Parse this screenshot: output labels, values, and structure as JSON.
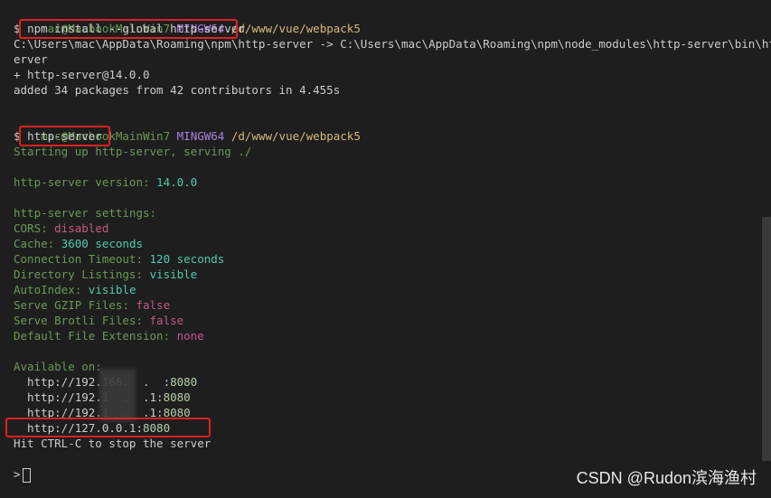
{
  "prompt1": {
    "user": "mac@MacbookMainWin7",
    "shell": "MINGW64",
    "path": "/d/www/vue/webpack5"
  },
  "cmd1": "npm install --global http-server",
  "install_out": [
    "C:\\Users\\mac\\AppData\\Roaming\\npm\\http-server -> C:\\Users\\mac\\AppData\\Roaming\\npm\\node_modules\\http-server\\bin\\http-s",
    "erver",
    "+ http-server@14.0.0",
    "added 34 packages from 42 contributors in 4.455s"
  ],
  "prompt2": {
    "user": "mac@MacbookMainWin7",
    "shell": "MINGW64",
    "path": "/d/www/vue/webpack5"
  },
  "cmd2": "http-server",
  "start_line": "Starting up http-server, serving ./",
  "version_label": "http-server version: ",
  "version": "14.0.0",
  "settings_title": "http-server settings:",
  "settings": [
    {
      "key": "CORS: ",
      "value": "disabled"
    },
    {
      "key": "Cache: ",
      "value": "3600 seconds"
    },
    {
      "key": "Connection Timeout: ",
      "value": "120 seconds"
    },
    {
      "key": "Directory Listings: ",
      "value": "visible"
    },
    {
      "key": "AutoIndex: ",
      "value": "visible"
    },
    {
      "key": "Serve GZIP Files: ",
      "value": "false"
    },
    {
      "key": "Serve Brotli Files: ",
      "value": "false"
    },
    {
      "key": "Default File Extension: ",
      "value": "none"
    }
  ],
  "available_title": "Available on:",
  "urls": [
    {
      "host": "  http://192.168.  .  ",
      "port": "8080"
    },
    {
      "host": "  http://192.1  .  .1",
      "port": "8080"
    },
    {
      "host": "  http://192.1  .  .1",
      "port": "8080"
    },
    {
      "host": "  http://127.0.0.1",
      "port": "8080"
    }
  ],
  "stop_hint": "Hit CTRL-C to stop the server",
  "prompt_symbol": ">",
  "watermark": "CSDN @Rudon滨海渔村",
  "colors": {
    "background": "#1e1e1e",
    "highlight_box": "#e02020"
  }
}
